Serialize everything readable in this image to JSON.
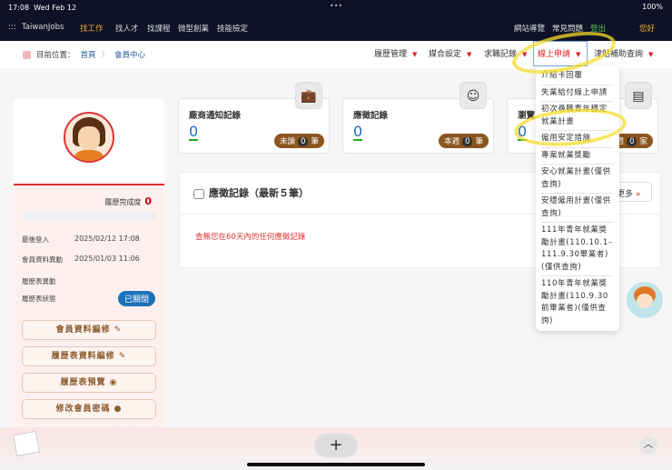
{
  "status": {
    "time": "17:08",
    "date": "Wed Feb 12",
    "battery": "100%"
  },
  "topnav": {
    "brand": "TaiwanJobs",
    "items": [
      "找工作",
      "找人才",
      "找課程",
      "微型創業",
      "技能檢定"
    ],
    "right": [
      "網站導覽",
      "常見問題",
      "登出",
      "您好"
    ]
  },
  "breadcrumb": {
    "label": "目前位置：",
    "home": "首頁",
    "current": "會員中心"
  },
  "menu": [
    "履歷管理",
    "媒合設定",
    "求職記錄",
    "線上申請",
    "津貼補助查詢"
  ],
  "dropdown": [
    "介紹卡回覆",
    "失業給付線上申請",
    "初次尋職青年穩定就業計畫",
    "僱用安定措施",
    "專案就業獎勵",
    "安心就業計畫(僅供查詢)",
    "安穩僱用計畫(僅供查詢)",
    "111年青年就業獎勵計畫(110.10.1–111.9.30畢業者)(僅供查詢)",
    "110年青年就業獎勵計畫(110.9.30前畢業者)(僅供查詢)"
  ],
  "sidebar": {
    "completion_label": "履歷完成度",
    "completion": "0",
    "completion_pct": 0,
    "last_login_label": "最後登入",
    "last_login": "2025/02/12 17:08",
    "member_change_label": "會員資料異動",
    "member_change": "2025/01/03 11:06",
    "resume_change_label": "履歷表異動",
    "resume_status_label": "履歷表狀態",
    "resume_status": "已關閉",
    "buttons": [
      "會員資料編修",
      "履歷表資料編修",
      "履歷表預覽",
      "修改會員密碼"
    ]
  },
  "cards": [
    {
      "title": "廠商通知記錄",
      "count": "0",
      "pill_a": "未讀",
      "pill_n": "0",
      "pill_b": "筆"
    },
    {
      "title": "應徵記錄",
      "count": "0",
      "pill_a": "本週",
      "pill_n": "0",
      "pill_b": "筆"
    },
    {
      "title": "瀏覽",
      "count": "0",
      "pill_a": "週",
      "pill_n": "0",
      "pill_b": "家"
    }
  ],
  "panel": {
    "title": "應徵記錄（最新５筆）",
    "more": "更多",
    "empty": "查無您在60天內的任何應徵記錄"
  },
  "bottom": {
    "plus": "+",
    "up": "︿"
  }
}
